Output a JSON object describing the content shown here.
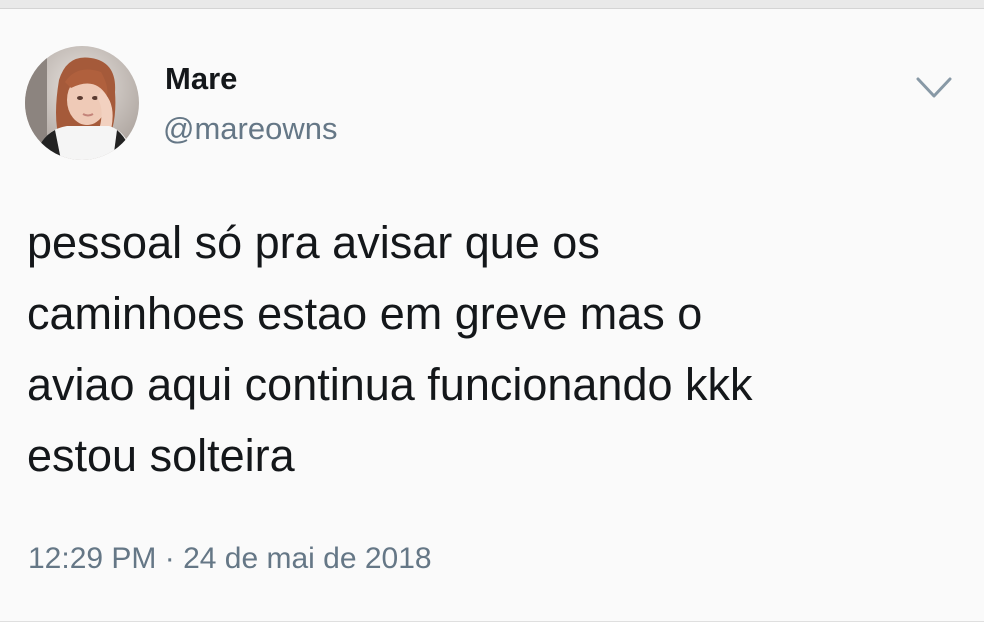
{
  "tweet": {
    "author": {
      "display_name": "Mare",
      "handle": "@mareowns",
      "avatar_icon": "profile-photo-avatar"
    },
    "menu_icon": "chevron-down-icon",
    "text_lines": [
      "pessoal só pra avisar que os",
      "caminhoes estao em greve mas o",
      "aviao aqui continua funcionando kkk",
      "estou solteira"
    ],
    "timestamp": "12:29 PM · 24 de mai de 2018"
  },
  "colors": {
    "text": "#14171a",
    "secondary_text": "#657786",
    "background": "#fafafa"
  }
}
